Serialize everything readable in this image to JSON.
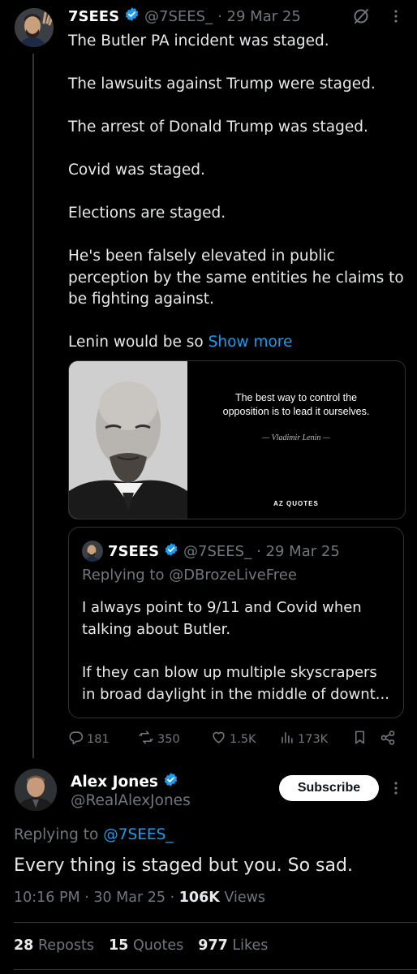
{
  "tweet1": {
    "name": "7SEES",
    "handle": "@7SEES_",
    "dot_date": "· 29 Mar 25",
    "paragraphs": [
      "The Butler PA incident was staged.",
      "The lawsuits against Trump were staged.",
      "The arrest of Donald Trump was staged.",
      "Covid was staged.",
      "Elections are staged.",
      "He's been falsely elevated in public perception by the same entities he claims to be fighting against."
    ],
    "last_line": "Lenin would be so",
    "show_more": "Show more",
    "image": {
      "quote_line1": "The best way to control the",
      "quote_line2": "opposition is to lead it ourselves.",
      "signature": "— Vladimir Lenin —",
      "brand": "AZ QUOTES"
    },
    "quote_tweet": {
      "name": "7SEES",
      "handle": "@7SEES_",
      "dot_date": "· 29 Mar 25",
      "replying_to": "Replying to @DBrozeLiveFree",
      "text1": "I always point to 9/11 and Covid when talking about Butler.",
      "text2": "If they can blow up multiple skyscrapers in broad daylight in the middle of downt..."
    },
    "actions": {
      "replies": "181",
      "reposts": "350",
      "likes": "1.5K",
      "views": "173K"
    }
  },
  "tweet2": {
    "name": "Alex Jones",
    "handle": "@RealAlexJones",
    "subscribe": "Subscribe",
    "replying_label": "Replying to",
    "replying_handle": "@7SEES_",
    "text": "Every thing is staged but you. So sad.",
    "time": "10:16 PM · 30 Mar 25 ·",
    "views_count": "106K",
    "views_label": "Views"
  },
  "stats": {
    "reposts_count": "28",
    "reposts_label": "Reposts",
    "quotes_count": "15",
    "quotes_label": "Quotes",
    "likes_count": "977",
    "likes_label": "Likes"
  },
  "colors": {
    "accent": "#1d9bf0",
    "text": "#e7e9ea",
    "muted": "#71767b",
    "bg": "#000000"
  },
  "icons": [
    "verified-badge-icon",
    "grok-icon",
    "more-options-icon",
    "reply-icon",
    "repost-icon",
    "like-icon",
    "views-icon",
    "bookmark-icon",
    "share-icon"
  ]
}
